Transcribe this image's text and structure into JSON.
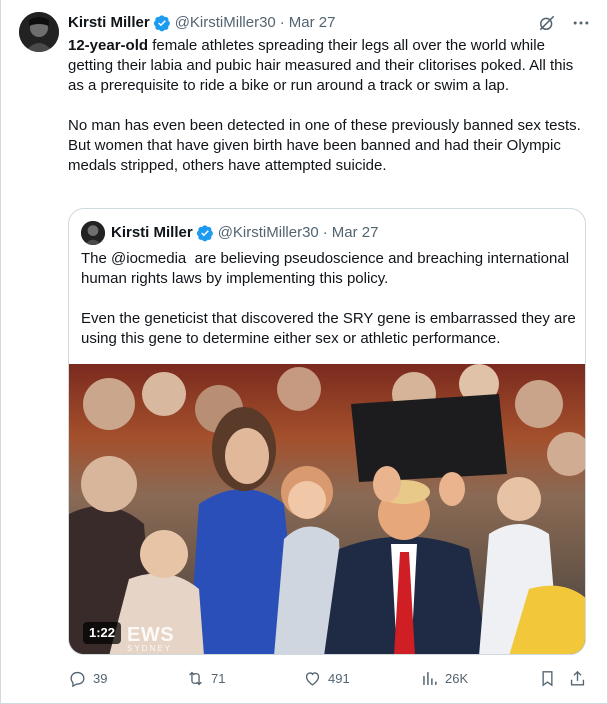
{
  "tweet": {
    "author_name": "Kirsti Miller",
    "author_handle": "@KirstiMiller30",
    "separator": "·",
    "date": "Mar 27",
    "text_lead": "12-year-old",
    "text_rest": " female athletes spreading their legs all over the world while getting their labia and pubic hair measured and their clitorises poked. All this as a prerequisite to ride a bike or run around a track or swim a lap.\n\nNo man has even been detected in one of these previously banned sex tests.\nBut women that have given birth have been banned and had their Olympic medals stripped, others have attempted suicide."
  },
  "quote": {
    "author_name": "Kirsti Miller",
    "author_handle": "@KirstiMiller30",
    "separator": "·",
    "date": "Mar 27",
    "text": "The @iocmedia  are believing pseudoscience and breaching international human rights laws by implementing this policy.\n\nEven the geneticist that discovered the SRY gene is embarrassed they are using this gene to determine either sex or athletic performance.",
    "video": {
      "duration": "1:22",
      "watermark": "EWS",
      "watermark_sub": "SYDNEY"
    }
  },
  "metrics": {
    "replies": "39",
    "retweets": "71",
    "likes": "491",
    "views": "26K"
  },
  "colors": {
    "verified": "#1d9bf0",
    "text": "#0f1419",
    "muted": "#536471",
    "border": "#cfd9de"
  },
  "icons": {
    "verified": "verified-badge-icon",
    "grok": "grok-icon",
    "more": "more-icon",
    "reply": "reply-icon",
    "retweet": "retweet-icon",
    "like": "heart-icon",
    "views": "views-icon",
    "bookmark": "bookmark-icon",
    "share": "share-icon"
  }
}
